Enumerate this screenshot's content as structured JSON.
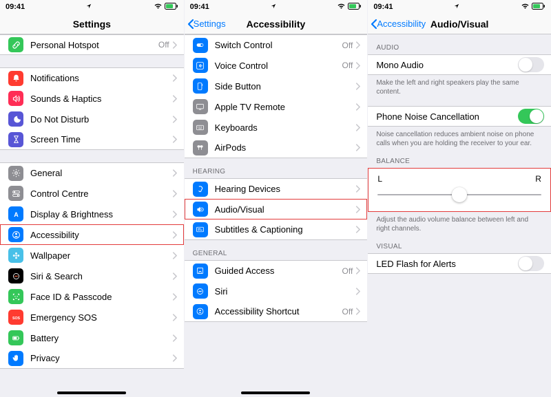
{
  "status": {
    "time": "09:41"
  },
  "screen1": {
    "title": "Settings",
    "groups": [
      {
        "rows": [
          {
            "icon": "link",
            "bg": "#34C759",
            "label": "Personal Hotspot",
            "value": "Off"
          }
        ]
      },
      {
        "rows": [
          {
            "icon": "bell",
            "bg": "#FF3B30",
            "label": "Notifications"
          },
          {
            "icon": "speaker",
            "bg": "#FF2D55",
            "label": "Sounds & Haptics"
          },
          {
            "icon": "moon",
            "bg": "#5856D6",
            "label": "Do Not Disturb"
          },
          {
            "icon": "hourglass",
            "bg": "#5856D6",
            "label": "Screen Time"
          }
        ]
      },
      {
        "rows": [
          {
            "icon": "gear",
            "bg": "#8E8E93",
            "label": "General"
          },
          {
            "icon": "switches",
            "bg": "#8E8E93",
            "label": "Control Centre"
          },
          {
            "icon": "sun",
            "bg": "#007AFF",
            "label": "Display & Brightness"
          },
          {
            "icon": "person",
            "bg": "#007AFF",
            "label": "Accessibility",
            "highlight": true
          },
          {
            "icon": "flower",
            "bg": "#48C0E8",
            "label": "Wallpaper"
          },
          {
            "icon": "siri",
            "bg": "#000000",
            "label": "Siri & Search"
          },
          {
            "icon": "faceid",
            "bg": "#34C759",
            "label": "Face ID & Passcode"
          },
          {
            "icon": "sos",
            "bg": "#FF3B30",
            "label": "Emergency SOS"
          },
          {
            "icon": "battery",
            "bg": "#34C759",
            "label": "Battery"
          },
          {
            "icon": "hand",
            "bg": "#007AFF",
            "label": "Privacy"
          }
        ]
      }
    ]
  },
  "screen2": {
    "back": "Settings",
    "title": "Accessibility",
    "groups": [
      {
        "rows": [
          {
            "icon": "switch-ctrl",
            "bg": "#007AFF",
            "label": "Switch Control",
            "value": "Off"
          },
          {
            "icon": "voice",
            "bg": "#007AFF",
            "label": "Voice Control",
            "value": "Off"
          },
          {
            "icon": "side-btn",
            "bg": "#007AFF",
            "label": "Side Button"
          },
          {
            "icon": "tv",
            "bg": "#8E8E93",
            "label": "Apple TV Remote"
          },
          {
            "icon": "keyboard",
            "bg": "#8E8E93",
            "label": "Keyboards"
          },
          {
            "icon": "airpods",
            "bg": "#8E8E93",
            "label": "AirPods"
          }
        ]
      },
      {
        "header": "HEARING",
        "rows": [
          {
            "icon": "ear",
            "bg": "#007AFF",
            "label": "Hearing Devices"
          },
          {
            "icon": "audio-desc",
            "bg": "#007AFF",
            "label": "Audio/Visual",
            "highlight": true
          },
          {
            "icon": "captions",
            "bg": "#007AFF",
            "label": "Subtitles & Captioning"
          }
        ]
      },
      {
        "header": "GENERAL",
        "rows": [
          {
            "icon": "guided",
            "bg": "#007AFF",
            "label": "Guided Access",
            "value": "Off"
          },
          {
            "icon": "siri2",
            "bg": "#007AFF",
            "label": "Siri"
          },
          {
            "icon": "shortcut",
            "bg": "#007AFF",
            "label": "Accessibility Shortcut",
            "value": "Off"
          }
        ]
      }
    ]
  },
  "screen3": {
    "back": "Accessibility",
    "title": "Audio/Visual",
    "sections": {
      "audio_header": "AUDIO",
      "mono": {
        "label": "Mono Audio",
        "on": false
      },
      "mono_footer": "Make the left and right speakers play the same content.",
      "noise": {
        "label": "Phone Noise Cancellation",
        "on": true
      },
      "noise_footer": "Noise cancellation reduces ambient noise on phone calls when you are holding the receiver to your ear.",
      "balance_header": "BALANCE",
      "balance": {
        "left": "L",
        "right": "R"
      },
      "balance_footer": "Adjust the audio volume balance between left and right channels.",
      "visual_header": "VISUAL",
      "led": {
        "label": "LED Flash for Alerts",
        "on": false
      }
    }
  }
}
